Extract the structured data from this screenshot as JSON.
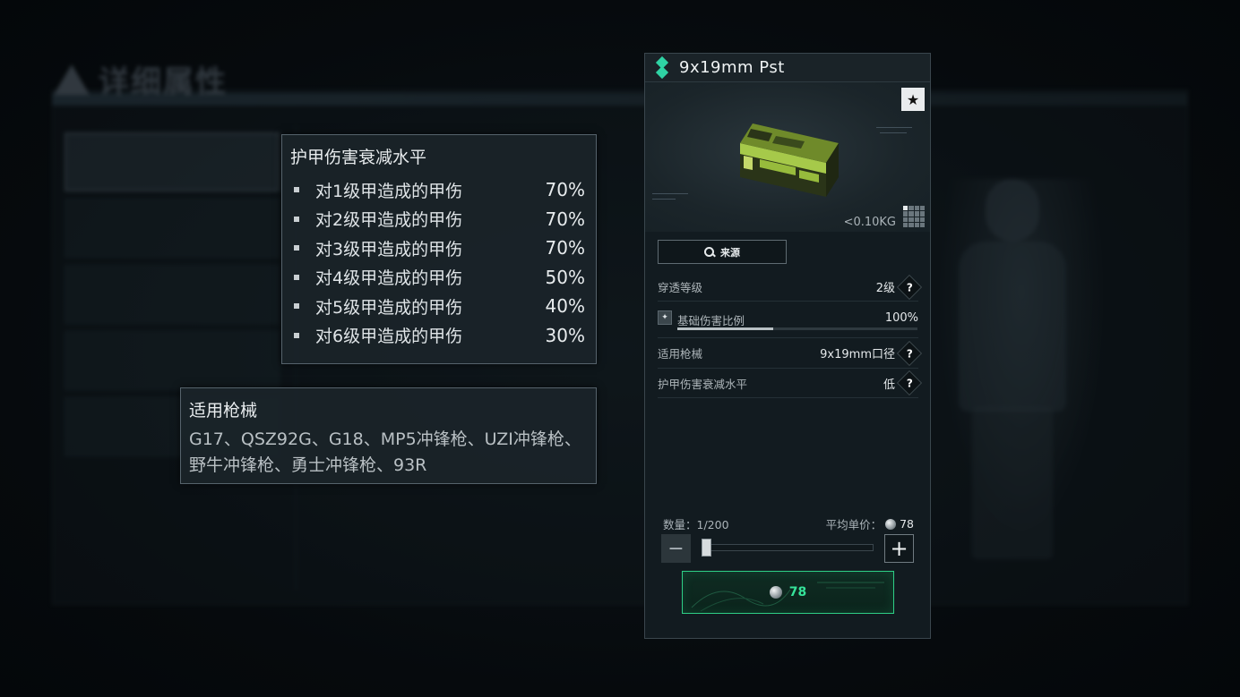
{
  "background": {
    "title": "详细属性"
  },
  "armor_tooltip": {
    "title": "护甲伤害衰减水平",
    "rows": [
      {
        "label": "对1级甲造成的甲伤",
        "value": "70%"
      },
      {
        "label": "对2级甲造成的甲伤",
        "value": "70%"
      },
      {
        "label": "对3级甲造成的甲伤",
        "value": "70%"
      },
      {
        "label": "对4级甲造成的甲伤",
        "value": "50%"
      },
      {
        "label": "对5级甲造成的甲伤",
        "value": "40%"
      },
      {
        "label": "对6级甲造成的甲伤",
        "value": "30%"
      }
    ]
  },
  "weapon_tooltip": {
    "title": "适用枪械",
    "body": "G17、QSZ92G、G18、MP5冲锋枪、UZI冲锋枪、野牛冲锋枪、勇士冲锋枪、93R"
  },
  "card": {
    "title": "9x19mm Pst",
    "rarity_color": "#2fd3a4",
    "favorite_icon": "star-icon",
    "weight": "<0.10KG",
    "source_label": "来源",
    "stats": {
      "penetration": {
        "label": "穿透等级",
        "value": "2级"
      },
      "base_damage": {
        "label": "基础伤害比例",
        "value": "100%",
        "fill_fraction": 0.4
      },
      "gun": {
        "label": "适用枪械",
        "value": "9x19mm口径"
      },
      "armor_damage": {
        "label": "护甲伤害衰减水平",
        "value": "低"
      }
    },
    "help_symbol": "?",
    "quantity_label": "数量：1/200",
    "avg_price_label": "平均单价：",
    "avg_price_value": "78",
    "minus_symbol": "−",
    "plus_symbol": "+",
    "buy_price": "78",
    "accent_color": "#2ecf86"
  }
}
